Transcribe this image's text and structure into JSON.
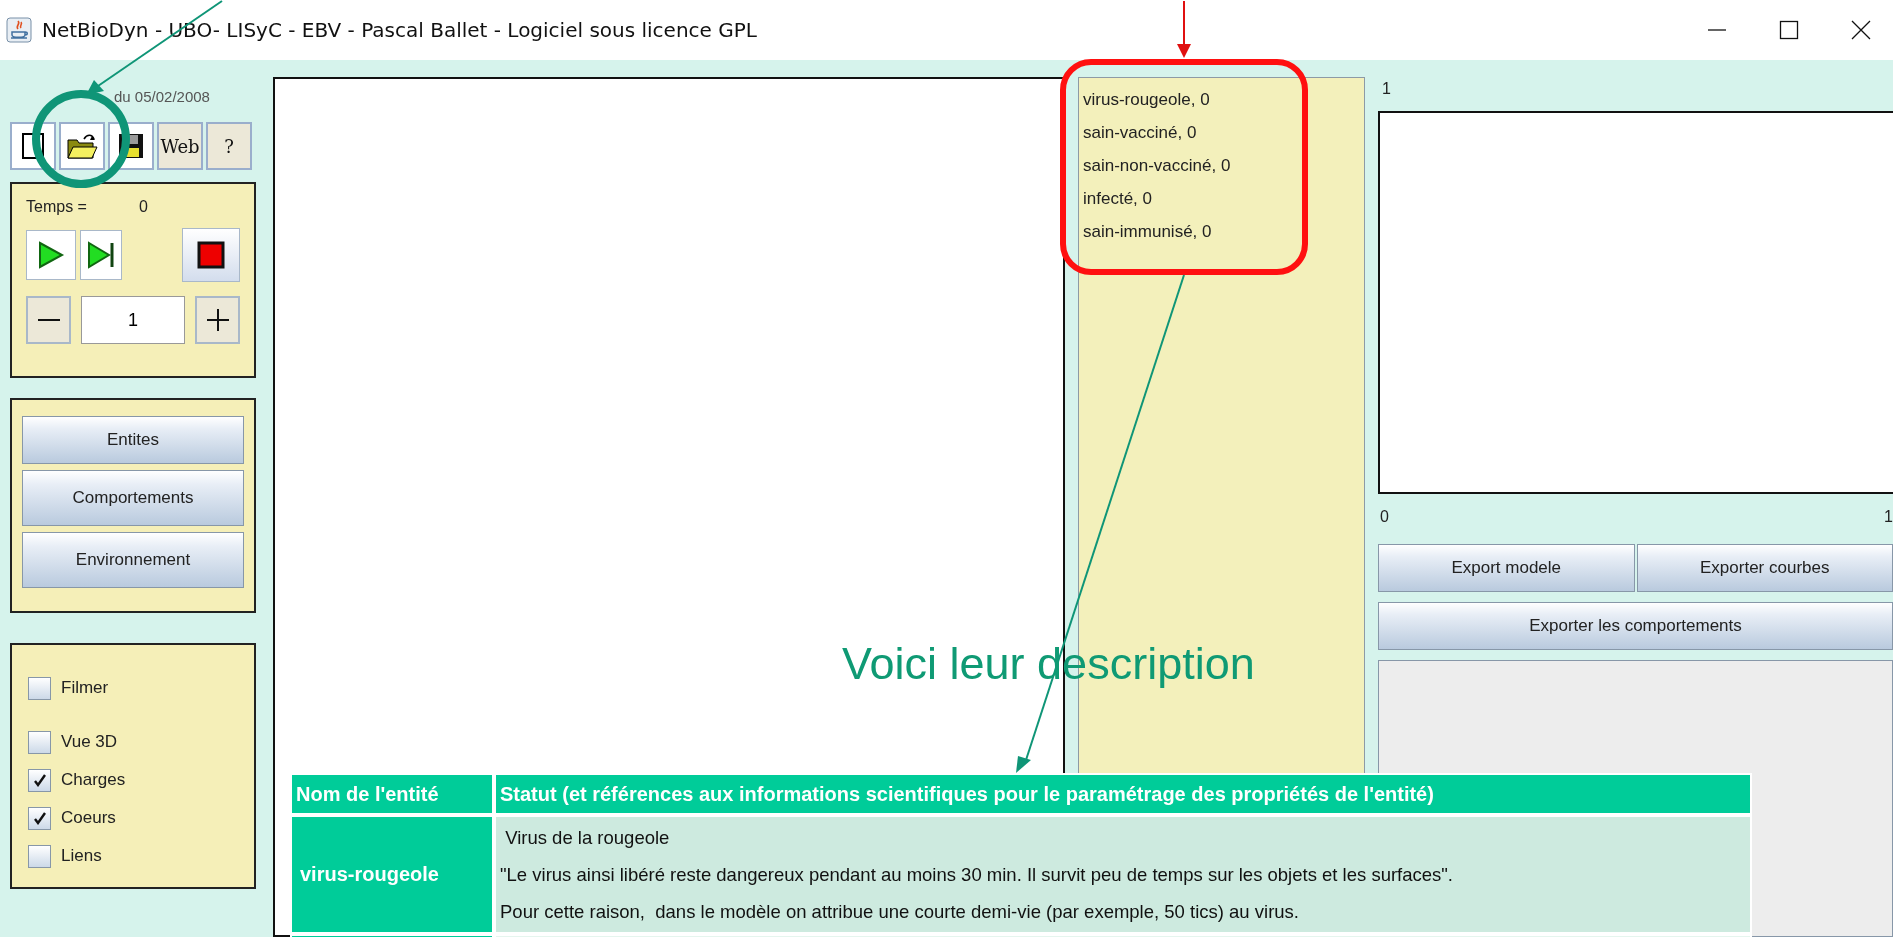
{
  "window": {
    "title": "NetBioDyn - UBO- LISyC - EBV - Pascal Ballet - Logiciel sous licence GPL"
  },
  "version": "du 05/02/2008",
  "toolbar": [
    {
      "kind": "new"
    },
    {
      "kind": "open"
    },
    {
      "kind": "save"
    },
    {
      "kind": "text",
      "label": "Web"
    },
    {
      "kind": "text",
      "label": "?"
    }
  ],
  "simulation": {
    "time_label": "Temps =",
    "time_value": "0",
    "step": "1"
  },
  "panel_buttons": [
    "Entites",
    "Comportements",
    "Environnement"
  ],
  "options": [
    {
      "label": "Filmer",
      "checked": false
    },
    {
      "label": "Vue 3D",
      "checked": false
    },
    {
      "label": "Charges",
      "checked": true
    },
    {
      "label": "Coeurs",
      "checked": true
    },
    {
      "label": "Liens",
      "checked": false
    }
  ],
  "entities": [
    "virus-rougeole, 0",
    "sain-vacciné, 0",
    "sain-non-vacciné, 0",
    "infecté, 0",
    "sain-immunisé, 0"
  ],
  "chart": {
    "top_label": "1",
    "x_start_label": "0",
    "x_end_label": "1"
  },
  "export_buttons": [
    "Export modele",
    "Exporter courbes",
    "Exporter les comportements"
  ],
  "annotation": {
    "caption": "Voici leur description",
    "table": {
      "columns": [
        "Nom de l'entité",
        "Statut (et références aux informations scientifiques pour le paramétrage des propriétés de l'entité)"
      ],
      "rows": [
        {
          "name": "virus-rougeole",
          "lines": [
            " Virus de la rougeole",
            "\"Le virus ainsi libéré reste dangereux pendant au moins 30 min. Il survit peu de temps sur les objets et les surfaces\".",
            "Pour cette raison,  dans le modèle on attribue une courte demi-vie (par exemple, 50 tics) au virus."
          ]
        }
      ]
    }
  }
}
